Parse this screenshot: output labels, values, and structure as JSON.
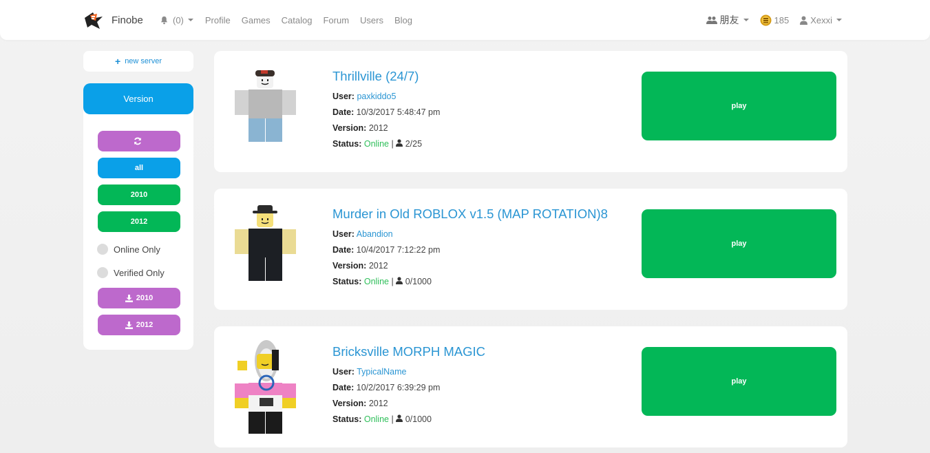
{
  "navbar": {
    "brand": "Finobe",
    "notifications": "(0)",
    "links": [
      "Profile",
      "Games",
      "Catalog",
      "Forum",
      "Users",
      "Blog"
    ],
    "friends": "朋友",
    "currency": "185",
    "username": "Xexxi"
  },
  "sidebar": {
    "new_server": "new server",
    "version_header": "Version",
    "filter_all": "all",
    "filter_2010": "2010",
    "filter_2012": "2012",
    "online_only": "Online Only",
    "verified_only": "Verified Only",
    "download_2010": "2010",
    "download_2012": "2012"
  },
  "labels": {
    "user": "User:",
    "date": "Date:",
    "version": "Version:",
    "status": "Status:",
    "play": "play"
  },
  "servers": [
    {
      "title": "Thrillville (24/7)",
      "user": "paxkiddo5",
      "date": "10/3/2017 5:48:47 pm",
      "version": "2012",
      "status": "Online",
      "players": "2/25"
    },
    {
      "title": "Murder in Old ROBLOX v1.5 (MAP ROTATION)8",
      "user": "Abandion",
      "date": "10/4/2017 7:12:22 pm",
      "version": "2012",
      "status": "Online",
      "players": "0/1000"
    },
    {
      "title": "Bricksville MORPH MAGIC",
      "user": "TypicalName",
      "date": "10/2/2017 6:39:29 pm",
      "version": "2012",
      "status": "Online",
      "players": "0/1000"
    }
  ],
  "colors": {
    "accent_blue": "#0aa0e8",
    "play_green": "#03b757",
    "purple": "#bd69cc",
    "link": "#2a95d3",
    "online": "#2fbf5a"
  }
}
